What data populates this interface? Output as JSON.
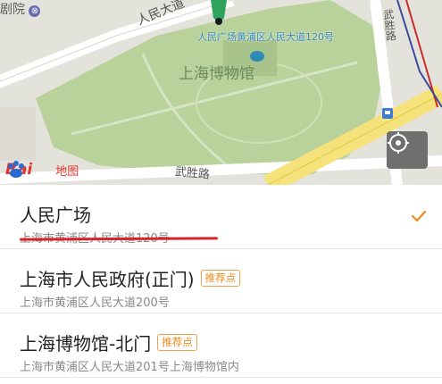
{
  "map": {
    "theater_label": "剧院",
    "road_renmin": "人民大道",
    "road_wusheng_right": "武胜路",
    "road_wusheng_bottom": "武胜路",
    "museum_label": "上海博物馆",
    "marker_label": "人民广场黄浦区人民大道120号",
    "logo_text": "Bai",
    "logo_text2": "地图",
    "colors": {
      "park": "#b9d29c",
      "road": "#ffffff",
      "marker": "#2ea35e",
      "metro_red": "#cc2a2a",
      "metro_blue": "#3a4aa0"
    }
  },
  "locate_button": {
    "icon": "locate-icon"
  },
  "places": [
    {
      "name": "人民广场",
      "address": "上海市黄浦区人民大道120号",
      "badge": "",
      "selected": true
    },
    {
      "name": "上海市人民政府(正门)",
      "address": "上海市黄浦区人民大道200号",
      "badge": "推荐点",
      "selected": false
    },
    {
      "name": "上海博物馆-北门",
      "address": "上海市黄浦区人民大道201号上海博物馆内",
      "badge": "推荐点",
      "selected": false
    }
  ],
  "colors": {
    "accent": "#f08a1c",
    "underline": "#d8232a"
  }
}
